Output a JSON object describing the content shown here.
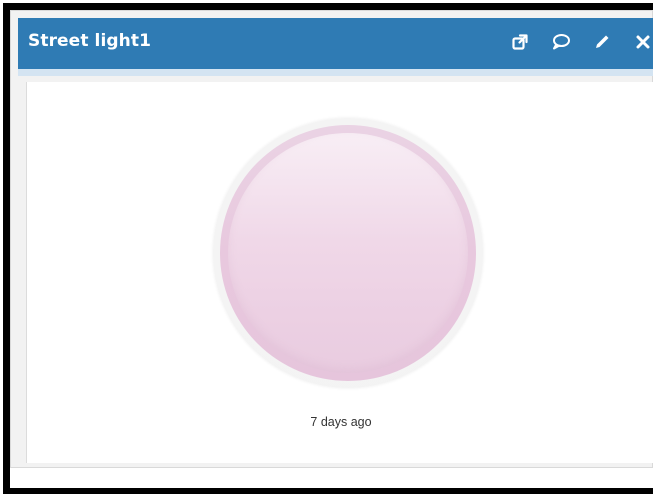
{
  "widget": {
    "title": "Street light1",
    "timestamp": "7 days ago",
    "led_color": "#ecd0e3"
  },
  "toolbar": {
    "icons": [
      "external-link-icon",
      "comment-icon",
      "pencil-icon",
      "close-icon"
    ]
  },
  "colors": {
    "header": "#2f7bb4",
    "header_text": "#ffffff"
  }
}
